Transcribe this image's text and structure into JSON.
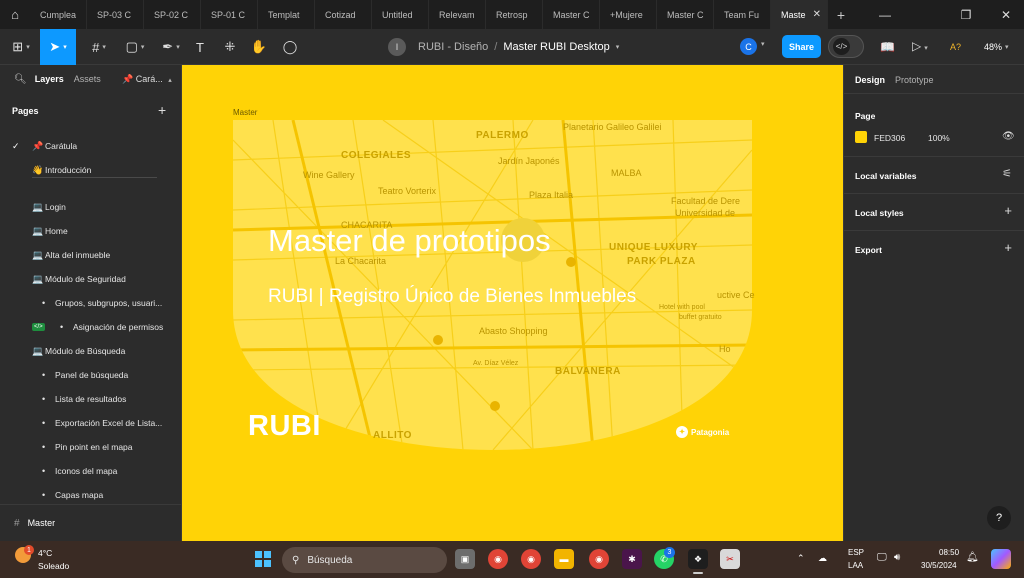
{
  "tabs": [
    {
      "label": "Cumplea"
    },
    {
      "label": "SP-03 C"
    },
    {
      "label": "SP-02 C"
    },
    {
      "label": "SP-01 C"
    },
    {
      "label": "Templat"
    },
    {
      "label": "Cotizad"
    },
    {
      "label": "Untitled"
    },
    {
      "label": "Relevam"
    },
    {
      "label": "Retrosp"
    },
    {
      "label": "Master C"
    },
    {
      "label": "+Mujere"
    },
    {
      "label": "Master C"
    },
    {
      "label": "Team Fu"
    }
  ],
  "active_tab": {
    "label": "Maste"
  },
  "toolbar": {
    "avatar_letter": "I",
    "project": "RUBI - Diseño",
    "separator": "/",
    "file_name": "Master RUBI Desktop",
    "user_letter": "C",
    "share_label": "Share",
    "warning_label": "A?",
    "zoom": "48%"
  },
  "left_panel": {
    "tab_layers": "Layers",
    "tab_assets": "Assets",
    "current_page": "Cará...",
    "pages_title": "Pages",
    "pages": [
      {
        "icon": "📌",
        "label": "Carátula",
        "selected": true
      },
      {
        "icon": "👋",
        "label": "Introducción"
      },
      {
        "icon": "💻",
        "label": "Login"
      },
      {
        "icon": "💻",
        "label": "Home"
      },
      {
        "icon": "💻",
        "label": "Alta del inmueble"
      },
      {
        "icon": "💻",
        "label": "Módulo de Seguridad"
      },
      {
        "icon": "•",
        "label": "Grupos, subgrupos, usuari..."
      },
      {
        "icon": "•",
        "label": "Asignación de permisos"
      },
      {
        "icon": "💻",
        "label": "Módulo de Búsqueda"
      },
      {
        "icon": "•",
        "label": "Panel de búsqueda"
      },
      {
        "icon": "•",
        "label": "Lista de resultados"
      },
      {
        "icon": "•",
        "label": "Exportación Excel de Lista..."
      },
      {
        "icon": "•",
        "label": "Pin point en el mapa"
      },
      {
        "icon": "•",
        "label": "Iconos del mapa"
      },
      {
        "icon": "•",
        "label": "Capas mapa"
      }
    ],
    "footer_frame": "Master"
  },
  "canvas": {
    "frame_label": "Master",
    "title": "Master de prototipos",
    "subtitle": "RUBI | Registro Único de Bienes Inmuebles",
    "logo": "RUBI",
    "brand": "Patagonia",
    "map_labels": [
      "PALERMO",
      "Planetario Galileo Galilei",
      "COLEGIALES",
      "Jardín Japonés",
      "Wine Gallery",
      "MALBA",
      "Teatro Vorterix",
      "Plaza Italia",
      "Facultad de Dere",
      "Universidad de",
      "CHACARITA",
      "La Chacarita",
      "UNIQUE LUXURY",
      "PARK PLAZA",
      "Abasto Shopping",
      "BALVANERA",
      "Av. Díaz Vélez",
      "ALLITO",
      "uctive Ce",
      "Hotel with pool",
      "buffet gratuito",
      "Ho"
    ]
  },
  "right_panel": {
    "tab_design": "Design",
    "tab_prototype": "Prototype",
    "page_section": "Page",
    "page_color_hex": "FED306",
    "page_color_opacity": "100%",
    "local_variables": "Local variables",
    "local_styles": "Local styles",
    "export": "Export",
    "help": "?"
  },
  "taskbar": {
    "weather_temp": "4°C",
    "weather_desc": "Soleado",
    "weather_badge": "1",
    "search_placeholder": "Búsqueda",
    "lang_top": "ESP",
    "lang_bottom": "LAA",
    "time": "08:50",
    "date": "30/5/2024",
    "whatsapp_badge": "3"
  },
  "colors": {
    "accent": "#0d99ff",
    "canvas_bg": "#FED306",
    "panel_bg": "#2c2c2c"
  }
}
